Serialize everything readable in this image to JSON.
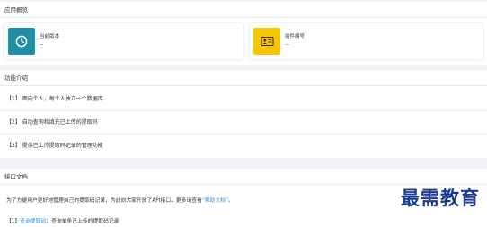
{
  "overview": {
    "title": "应用概览",
    "cards": [
      {
        "label": "当前版本",
        "value": "--",
        "icon": "clock-icon",
        "color": "#1e8fa6"
      },
      {
        "label": "插件编号",
        "value": "--",
        "icon": "id-card-icon",
        "color": "#f7c600"
      }
    ]
  },
  "features": {
    "title": "功能介绍",
    "items": [
      {
        "num": "【1】",
        "text": "面向个人，每个人独立一个数据库"
      },
      {
        "num": "【2】",
        "text": "自动查询和填充已上传的提取码"
      },
      {
        "num": "【3】",
        "text": "提供已上传提取码记录的管理功能"
      }
    ]
  },
  "api": {
    "title": "接口文档",
    "desc_prefix": "为了方便用户更好地管理自己的提取码记录，为此向大家开放了API接口。更多请查看",
    "desc_link": "“帮助文档”",
    "desc_suffix": "。",
    "item_num": "【1】",
    "item_link": "查询提取码",
    "item_text": "：查询单条已上传的提取码记录"
  },
  "watermark": "最需教育"
}
